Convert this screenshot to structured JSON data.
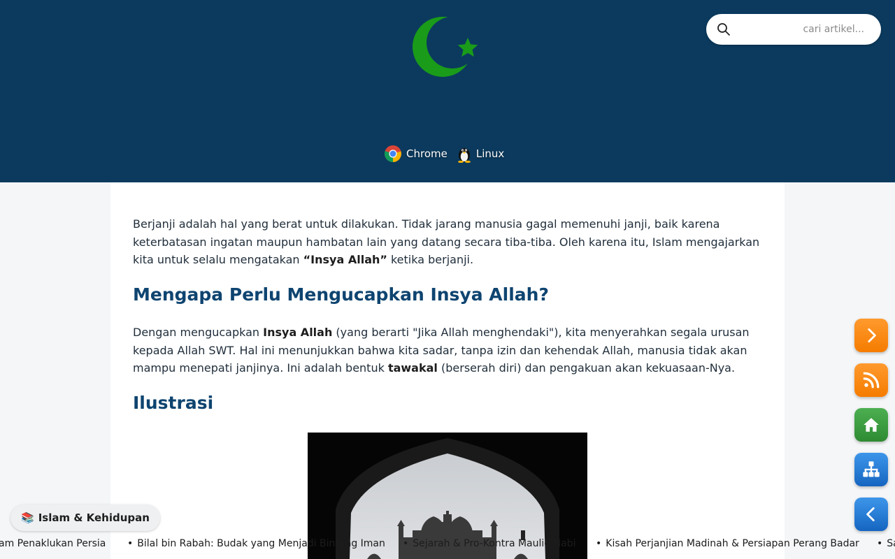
{
  "header": {
    "logo_icon": "crescent-star-icon",
    "colors": {
      "background": "#0b3a5e",
      "logo": "#1a9b1a"
    },
    "search": {
      "placeholder": "cari artikel...",
      "value": "",
      "icon": "search-icon"
    },
    "platforms": [
      {
        "label": "Chrome",
        "icon": "chrome-icon"
      },
      {
        "label": "Linux",
        "icon": "tux-penguin-icon"
      }
    ]
  },
  "article": {
    "intro": {
      "before": "Berjanji adalah hal yang berat untuk dilakukan. Tidak jarang manusia gagal memenuhi janji, baik karena keterbatasan ingatan maupun hambatan lain yang datang secara tiba-tiba. Oleh karena itu, Islam mengajarkan kita untuk selalu mengatakan ",
      "bold": "“Insya Allah”",
      "after": " ketika berjanji."
    },
    "heading1": "Mengapa Perlu Mengucapkan Insya Allah?",
    "para2": {
      "t1": "Dengan mengucapkan ",
      "b1": "Insya Allah",
      "t2": " (yang berarti \"Jika Allah menghendaki\"), kita menyerahkan segala urusan kepada Allah SWT. Hal ini menunjukkan bahwa kita sadar, tanpa izin dan kehendak Allah, manusia tidak akan mampu menepati janjinya. Ini adalah bentuk ",
      "b2": "tawakal",
      "t3": " (berserah diri) dan pengakuan akan kekuasaan-Nya."
    },
    "heading2": "Ilustrasi",
    "illustration_icon": "mosque-arch-photo"
  },
  "side_buttons": [
    {
      "icon": "chevron-right-icon",
      "color": "#f57c00"
    },
    {
      "icon": "rss-icon",
      "color": "#f57c00"
    },
    {
      "icon": "home-icon",
      "color": "#2e8b32"
    },
    {
      "icon": "sitemap-icon",
      "color": "#1565c0"
    },
    {
      "icon": "chevron-left-icon",
      "color": "#1565c0"
    }
  ],
  "category_badge": {
    "emoji": "📚",
    "label": "Islam & Kehidupan"
  },
  "ticker": {
    "bullet": "•",
    "items": [
      "am Penaklukan Persia",
      "Bilal bin Rabah: Budak yang Menjadi Bintang Iman",
      "Sejarah & Pro-Kontra Maulid Nabi",
      "Kisah Perjanjian Madinah & Persiapan Perang Badar",
      "Sa"
    ]
  }
}
